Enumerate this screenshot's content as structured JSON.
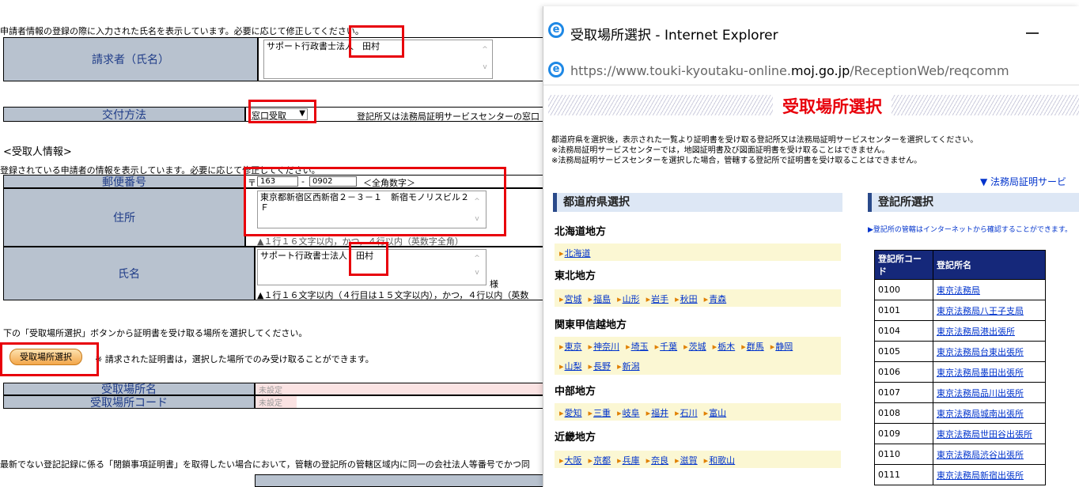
{
  "main": {
    "top_note": "申請者情報の登録の際に入力された氏名を表示しています。必要に応じて修正してください。",
    "requester_label": "請求者（氏名）",
    "requester_value": "サポート行政書士法人　田村",
    "delivery_label": "交付方法",
    "delivery_select": "窓口受取",
    "delivery_note": "登記所又は法務局証明サービスセンターの窓口",
    "recipient_heading": "<受取人情報>",
    "recipient_note": "登録されている申請者の情報を表示しています。必要に応じて修正してください。",
    "postal_label": "郵便番号",
    "postal_prefix": "〒",
    "postal_1": "163",
    "postal_sep": "-",
    "postal_2": "0902",
    "postal_hint": "＜全角数字＞",
    "address_label": "住所",
    "address_value": "東京都新宿区西新宿２－３－１　新宿モノリスビル２\nＦ",
    "address_hint": "▲１行１６文字以内，かつ，４行以内（英数字全角）",
    "name_label": "氏名",
    "name_value": "サポート行政書士法人　田村",
    "name_suffix": "様",
    "name_hint": "▲１行１６文字以内（４行目は１５文字以内），かつ，４行以内（英数",
    "select_instruction": "下の「受取場所選択」ボタンから証明書を受け取る場所を選択してください。",
    "select_button": "受取場所選択",
    "select_button_note": "※ 請求された証明書は，選択した場所でのみ受け取ることができます。",
    "place_name_label": "受取場所名",
    "place_name_value": "未設定",
    "place_code_label": "受取場所コード",
    "place_code_value": "未設定",
    "bottom_note": "最新でない登記記録に係る「閉鎖事項証明書」を取得したい場合において，管轄の登記所の管轄区域内に同一の会社法人等番号でかつ同"
  },
  "popup": {
    "window_title": "受取場所選択 - Internet Explorer",
    "url_prefix": "https://www.touki-kyoutaku-online.",
    "url_domain": "moj.go.jp",
    "url_suffix": "/ReceptionWeb/reqcomm",
    "page_title": "受取場所選択",
    "instr1": "都道府県を選択後，表示された一覧より証明書を受け取る登記所又は法務局証明サービスセンターを選択してください。",
    "instr2": "※法務局証明サービスセンターでは，地図証明書及び図面証明書を受け取ることはできません。",
    "instr3": "※法務局証明サービスセンターを選択した場合，管轄する登記所で証明書を受け取ることはできません。",
    "service_link": "▼ 法務局証明サービ",
    "pref_heading": "都道府県選択",
    "office_heading": "登記所選択",
    "office_note": "▶登記所の管轄はインターネットから確認することができます。",
    "regions": [
      {
        "name": "北海道地方",
        "prefs": [
          "北海道"
        ]
      },
      {
        "name": "東北地方",
        "prefs": [
          "宮城",
          "福島",
          "山形",
          "岩手",
          "秋田",
          "青森"
        ]
      },
      {
        "name": "関東甲信越地方",
        "prefs": [
          "東京",
          "神奈川",
          "埼玉",
          "千葉",
          "茨城",
          "栃木",
          "群馬",
          "静岡"
        ],
        "prefs2": [
          "山梨",
          "長野",
          "新潟"
        ]
      },
      {
        "name": "中部地方",
        "prefs": [
          "愛知",
          "三重",
          "岐阜",
          "福井",
          "石川",
          "富山"
        ]
      },
      {
        "name": "近畿地方",
        "prefs": [
          "大阪",
          "京都",
          "兵庫",
          "奈良",
          "滋賀",
          "和歌山"
        ]
      }
    ],
    "table_headers": [
      "登記所コード",
      "登記所名"
    ],
    "offices": [
      {
        "code": "0100",
        "name": "東京法務局"
      },
      {
        "code": "0101",
        "name": "東京法務局八王子支局"
      },
      {
        "code": "0104",
        "name": "東京法務局港出張所"
      },
      {
        "code": "0105",
        "name": "東京法務局台東出張所"
      },
      {
        "code": "0106",
        "name": "東京法務局墨田出張所"
      },
      {
        "code": "0107",
        "name": "東京法務局品川出張所"
      },
      {
        "code": "0108",
        "name": "東京法務局城南出張所"
      },
      {
        "code": "0109",
        "name": "東京法務局世田谷出張所"
      },
      {
        "code": "0110",
        "name": "東京法務局渋谷出張所"
      },
      {
        "code": "0111",
        "name": "東京法務局新宿出張所"
      }
    ],
    "minimize_icon": "minimize-icon",
    "colors": {
      "accent_red": "#e8000b",
      "label_bg": "#b8c2cf",
      "table_head": "#15287a"
    }
  }
}
